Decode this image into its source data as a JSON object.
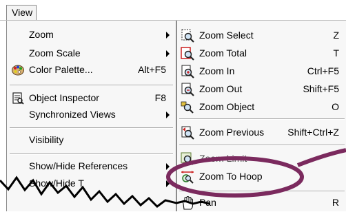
{
  "menubar": {
    "view_label": "View"
  },
  "main_menu": {
    "items": [
      {
        "label": "Zoom",
        "accel": "",
        "submenu": true,
        "icon": ""
      },
      {
        "label": "Zoom Scale",
        "accel": "",
        "submenu": true,
        "icon": ""
      },
      {
        "label": "Color Palette...",
        "accel": "Alt+F5",
        "submenu": false,
        "icon": "color-palette-icon"
      },
      {
        "label": "Object Inspector",
        "accel": "F8",
        "submenu": false,
        "icon": "object-inspector-icon"
      },
      {
        "label": "Synchronized Views",
        "accel": "",
        "submenu": true,
        "icon": ""
      },
      {
        "label": "Visibility",
        "accel": "",
        "submenu": false,
        "icon": ""
      },
      {
        "label": "Show/Hide References",
        "accel": "",
        "submenu": true,
        "icon": ""
      },
      {
        "label": "Show/Hide T",
        "accel": "",
        "submenu": true,
        "icon": ""
      }
    ]
  },
  "zoom_submenu": {
    "items": [
      {
        "label": "Zoom Select",
        "accel": "Z",
        "icon": "zoom-select-icon"
      },
      {
        "label": "Zoom Total",
        "accel": "T",
        "icon": "zoom-total-icon"
      },
      {
        "label": "Zoom In",
        "accel": "Ctrl+F5",
        "icon": "zoom-in-icon"
      },
      {
        "label": "Zoom Out",
        "accel": "Shift+F5",
        "icon": "zoom-out-icon"
      },
      {
        "label": "Zoom Object",
        "accel": "O",
        "icon": "zoom-object-icon"
      },
      {
        "label": "Zoom Previous",
        "accel": "Shift+Ctrl+Z",
        "icon": "zoom-previous-icon"
      },
      {
        "label": "Zoom Limit",
        "accel": "",
        "icon": "zoom-limit-icon"
      },
      {
        "label": "Zoom To Hoop",
        "accel": "",
        "icon": "zoom-to-hoop-icon"
      },
      {
        "label": "Pan",
        "accel": "R",
        "icon": "pan-hand-icon"
      }
    ]
  },
  "colors": {
    "highlight_ellipse": "#7b2a5e",
    "zoom_icon_red": "#cc1f1f",
    "zoom_icon_lens": "#3a6ea8"
  }
}
